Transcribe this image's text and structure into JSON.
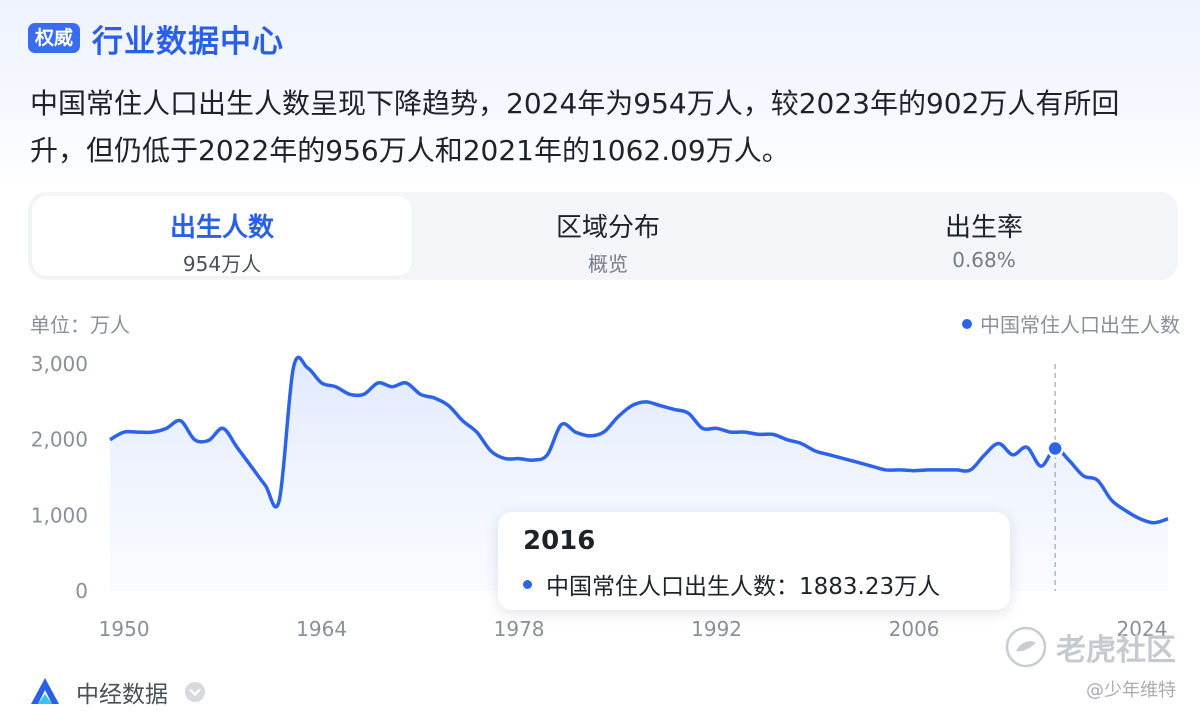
{
  "header": {
    "badge": "权威",
    "title": "行业数据中心"
  },
  "summary": "中国常住人口出生人数呈现下降趋势，2024年为954万人，较2023年的902万人有所回升，但仍低于2022年的956万人和2021年的1062.09万人。",
  "tabs": [
    {
      "label": "出生人数",
      "value": "954万人",
      "active": true
    },
    {
      "label": "区域分布",
      "value": "概览",
      "active": false
    },
    {
      "label": "出生率",
      "value": "0.68%",
      "active": false
    }
  ],
  "chart_data": {
    "type": "area",
    "unit_label": "单位：万人",
    "legend": [
      {
        "name": "中国常住人口出生人数",
        "color": "#2d63e6"
      }
    ],
    "legend_position": "top-right",
    "x_ticks": [
      "1950",
      "1964",
      "1978",
      "1992",
      "2006",
      "2024"
    ],
    "y_ticks": [
      "0",
      "1,000",
      "2,000",
      "3,000"
    ],
    "ylim": [
      0,
      3000
    ],
    "xlim": [
      1949,
      2024
    ],
    "grid": false,
    "series": [
      {
        "name": "中国常住人口出生人数",
        "color": "#2d63e6",
        "x": [
          1949,
          1950,
          1951,
          1952,
          1953,
          1954,
          1955,
          1956,
          1957,
          1958,
          1959,
          1960,
          1961,
          1962,
          1963,
          1964,
          1965,
          1966,
          1967,
          1968,
          1969,
          1970,
          1971,
          1972,
          1973,
          1974,
          1975,
          1976,
          1977,
          1978,
          1979,
          1980,
          1981,
          1982,
          1983,
          1984,
          1985,
          1986,
          1987,
          1988,
          1989,
          1990,
          1991,
          1992,
          1993,
          1994,
          1995,
          1996,
          1997,
          1998,
          1999,
          2000,
          2001,
          2002,
          2003,
          2004,
          2005,
          2006,
          2007,
          2008,
          2009,
          2010,
          2011,
          2012,
          2013,
          2014,
          2015,
          2016,
          2017,
          2018,
          2019,
          2020,
          2021,
          2022,
          2023,
          2024
        ],
        "values": [
          2000,
          2100,
          2100,
          2100,
          2150,
          2250,
          2000,
          1990,
          2150,
          1900,
          1650,
          1400,
          1200,
          2950,
          2950,
          2750,
          2700,
          2600,
          2600,
          2750,
          2700,
          2750,
          2600,
          2550,
          2450,
          2250,
          2100,
          1850,
          1750,
          1750,
          1730,
          1800,
          2200,
          2100,
          2050,
          2100,
          2300,
          2450,
          2500,
          2450,
          2400,
          2350,
          2150,
          2150,
          2100,
          2100,
          2070,
          2070,
          2000,
          1950,
          1850,
          1800,
          1750,
          1700,
          1650,
          1600,
          1600,
          1590,
          1600,
          1600,
          1600,
          1600,
          1800,
          1950,
          1800,
          1900,
          1650,
          1883.23,
          1723,
          1523,
          1465,
          1200,
          1062.09,
          956,
          902,
          954
        ]
      }
    ],
    "tooltip": {
      "year": "2016",
      "series_name": "中国常住人口出生人数：",
      "value": "1883.23万人"
    }
  },
  "footer": {
    "source": "中经数据"
  },
  "watermark": {
    "name": "老虎社区",
    "handle": "@少年维特"
  }
}
